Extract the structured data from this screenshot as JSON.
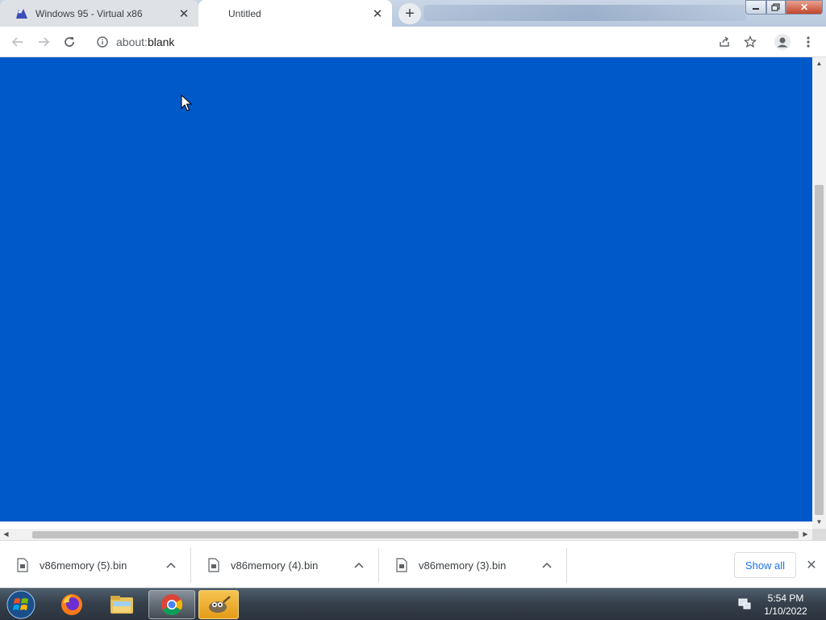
{
  "tabs": [
    {
      "title": "Windows 95 - Virtual x86",
      "favicon": "v86-icon",
      "active": false
    },
    {
      "title": "Untitled",
      "favicon": "",
      "active": true
    }
  ],
  "new_tab": {
    "icon": "plus-icon"
  },
  "window_controls": {
    "minimize": "minimize-icon",
    "maximize": "restore-icon",
    "close": "close-icon"
  },
  "toolbar": {
    "back_icon": "back-arrow-icon",
    "forward_icon": "forward-arrow-icon",
    "reload_icon": "reload-icon",
    "info_icon": "info-icon",
    "url_scheme": "about:",
    "url_rest": "blank",
    "share_icon": "share-icon",
    "bookmark_icon": "star-icon",
    "profile_icon": "profile-icon",
    "menu_icon": "kebab-menu-icon"
  },
  "content": {
    "background": "#0059c8"
  },
  "downloads": [
    {
      "name": "v86memory (5).bin"
    },
    {
      "name": "v86memory (4).bin"
    },
    {
      "name": "v86memory (3).bin"
    }
  ],
  "download_shelf": {
    "show_all": "Show all"
  },
  "taskbar": {
    "apps": [
      "start-orb-icon",
      "firefox-icon",
      "file-explorer-icon",
      "chrome-icon",
      "gimp-icon"
    ],
    "clock_time": "5:54 PM",
    "clock_date": "1/10/2022"
  }
}
